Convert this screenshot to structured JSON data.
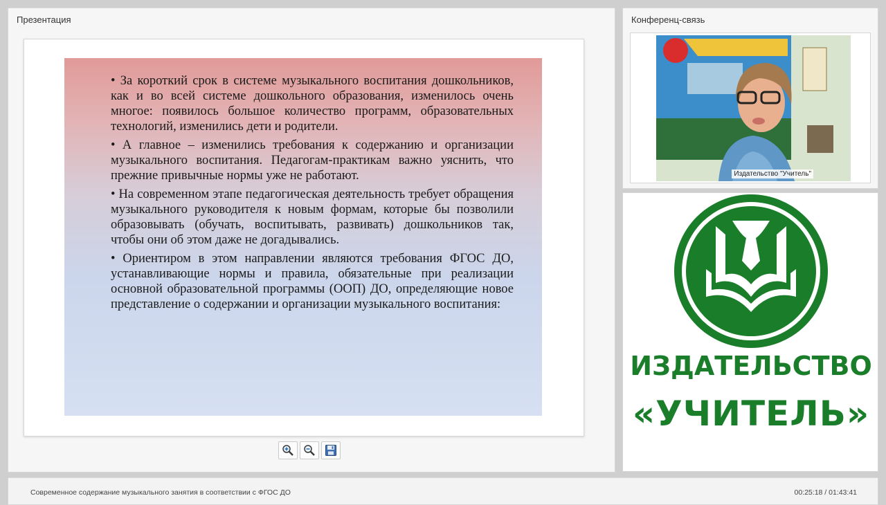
{
  "presentation": {
    "panel_title": "Презентация",
    "slide": {
      "bullets": [
        "• За короткий срок в системе музыкального воспитания дошкольников, как и во всей системе дошкольного образования, изменилось очень многое: появилось большое количество программ, образовательных технологий, изменились дети и родители.",
        "• А главное – изменились требования к содержанию и организации музыкального воспитания. Педагогам-практикам важно уяснить, что прежние привычные нормы уже не работают.",
        "• На современном этапе педагогическая деятельность требует обращения музыкального руководителя к новым формам, которые бы позволили образовывать (обучать, воспитывать, развивать) дошкольников так, чтобы они об этом даже не догадывались.",
        "• Ориентиром в этом направлении являются требования ФГОС ДО, устанавливающие нормы и правила, обязательные при реализации основной образовательной программы (ООП) ДО, определяющие новое представление о содержании и организации музыкального воспитания:"
      ]
    },
    "tools": [
      "zoom-in-icon",
      "zoom-out-icon",
      "save-icon"
    ]
  },
  "conference": {
    "panel_title": "Конференц-связь",
    "speaker_caption": "Издательство \"Учитель\""
  },
  "logo": {
    "line1": "ИЗДАТЕЛЬСТВО",
    "line2": "«УЧИТЕЛЬ»",
    "color": "#1a7d2a"
  },
  "footer": {
    "title": "Современное содержание музыкального занятия в соответствии с ФГОС ДО",
    "time": "00:25:18 / 01:43:41"
  }
}
